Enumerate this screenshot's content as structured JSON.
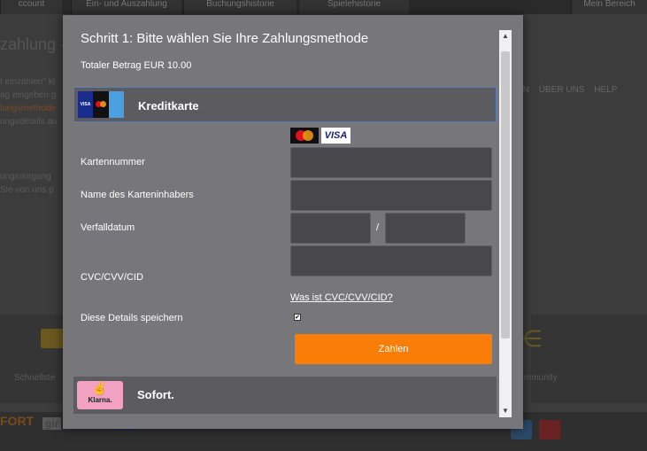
{
  "background": {
    "tabs": [
      "ccount",
      "Ein- und Auszahlung",
      "Buchungshistorie",
      "Spielehistorie",
      "Mein Bereich"
    ],
    "title_fragment": "zahlung —",
    "nav": [
      "IN",
      "ÜBER UNS",
      "HELP"
    ],
    "text_lines": [
      "t einzahlen\" kl",
      "ag eingeben g",
      "lungsmethode",
      "ungsdetails au"
    ],
    "text_lines_2": [
      "ungsvorgang",
      "Sie von uns p"
    ],
    "tile_labels": [
      "Schnellste",
      "mmunity"
    ],
    "footer_logos": [
      "FORT",
      "gir",
      "VISA"
    ]
  },
  "modal": {
    "title": "Schritt 1: Bitte wählen Sie Ihre Zahlungsmethode",
    "total": "Totaler Betrag EUR 10.00",
    "methods": {
      "card": {
        "label": "Kreditkarte",
        "logo_text": "VISA"
      },
      "sofort": {
        "label": "Sofort.",
        "logo_text": "Klarna."
      }
    },
    "brands": {
      "visa": "VISA"
    },
    "fields": {
      "card_number": {
        "label": "Kartennummer",
        "value": ""
      },
      "holder": {
        "label": "Name des Karteninhabers",
        "value": ""
      },
      "expiry": {
        "label": "Verfalldatum",
        "month": "",
        "year": "",
        "separator": "/"
      },
      "cvc": {
        "label": "CVC/CVV/CID",
        "value": ""
      }
    },
    "cvc_help_link": "Was ist CVC/CVV/CID?",
    "save_details": {
      "label": "Diese Details speichern",
      "checked": true
    },
    "pay_button": "Zahlen",
    "colors": {
      "accent": "#f97d06",
      "modal_bg": "#77767a",
      "selected_border": "#5b7fb0"
    }
  }
}
